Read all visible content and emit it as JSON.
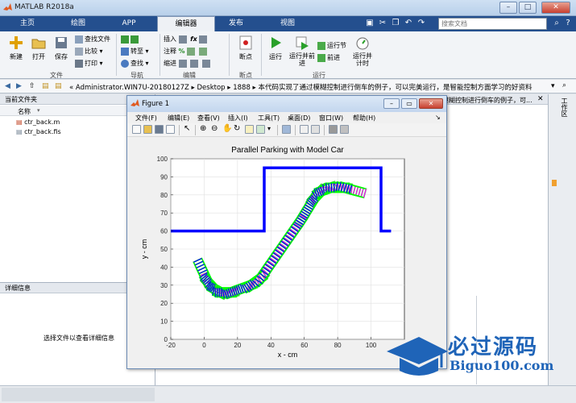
{
  "window": {
    "title": "MATLAB R2018a",
    "minimize": "–",
    "maximize": "□",
    "close": "✕"
  },
  "tabs": [
    {
      "label": "主页"
    },
    {
      "label": "绘图"
    },
    {
      "label": "APP"
    },
    {
      "label": "编辑器"
    },
    {
      "label": "发布"
    },
    {
      "label": "视图"
    }
  ],
  "search": {
    "placeholder": "搜索文档"
  },
  "ribbon": {
    "file": {
      "new": "新建",
      "open": "打开",
      "save": "保存",
      "find_files": "查找文件",
      "compare": "比较",
      "print": "打印",
      "group": "文件"
    },
    "navigate": {
      "goto": "转至",
      "find": "查找",
      "group": "导航"
    },
    "edit": {
      "insert": "插入",
      "comment": "注释",
      "indent": "缩进",
      "group": "编辑"
    },
    "breakpoints": {
      "breakpoint": "断点",
      "group": "断点"
    },
    "run": {
      "run": "运行",
      "run_advance": "运行并前进",
      "run_section": "运行节",
      "advance": "前进",
      "run_time": "运行并计时",
      "group": "运行"
    }
  },
  "address": {
    "path": "« Administrator.WIN7U-20180127Z  ▸  Desktop  ▸  1888  ▸  本代码实现了通过模糊控制进行倒车的例子，可以完美运行，是智能控制方面学习的好资料"
  },
  "file_panel": {
    "title": "当前文件夹",
    "column_name": "名称",
    "files": [
      {
        "name": "ctr_back.m"
      },
      {
        "name": "ctr_back.fis"
      }
    ]
  },
  "detail_panel": {
    "title": "详细信息",
    "hint": "选择文件以查看详细信息"
  },
  "cmd_area": {
    "title_snippet": "模糊控制进行倒车的例子，可..."
  },
  "right_panel": {
    "title": "工作区"
  },
  "figure": {
    "title": "Figure 1",
    "menu": [
      {
        "label": "文件(F)"
      },
      {
        "label": "编辑(E)"
      },
      {
        "label": "查看(V)"
      },
      {
        "label": "插入(I)"
      },
      {
        "label": "工具(T)"
      },
      {
        "label": "桌面(D)"
      },
      {
        "label": "窗口(W)"
      },
      {
        "label": "帮助(H)"
      }
    ]
  },
  "watermark": {
    "brand": "必过源码",
    "url": "Biguo100.com"
  },
  "chart_data": {
    "type": "line",
    "title": "Parallel Parking with Model Car",
    "xlabel": "x - cm",
    "ylabel": "y - cm",
    "xlim": [
      -20,
      120
    ],
    "ylim": [
      0,
      100
    ],
    "xticks": [
      -20,
      0,
      20,
      40,
      60,
      80,
      100
    ],
    "yticks": [
      0,
      10,
      20,
      30,
      40,
      50,
      60,
      70,
      80,
      90,
      100
    ],
    "grid": true,
    "boundary": {
      "color": "#0000ff",
      "x": [
        -20,
        36,
        36,
        106,
        106,
        112
      ],
      "y": [
        60,
        60,
        95,
        95,
        60,
        60
      ]
    },
    "trajectory": [
      [
        -2,
        40
      ],
      [
        2,
        32
      ],
      [
        6,
        28
      ],
      [
        10,
        26
      ],
      [
        16,
        26
      ],
      [
        22,
        28
      ],
      [
        28,
        30
      ],
      [
        34,
        34
      ],
      [
        40,
        42
      ],
      [
        46,
        50
      ],
      [
        52,
        58
      ],
      [
        58,
        66
      ],
      [
        62,
        72
      ],
      [
        66,
        78
      ],
      [
        70,
        82
      ],
      [
        76,
        84
      ],
      [
        84,
        84
      ],
      [
        92,
        82
      ]
    ],
    "colors": {
      "body": "#00ff00",
      "wheel": "#0000ff",
      "front": "#ff00ff"
    }
  }
}
